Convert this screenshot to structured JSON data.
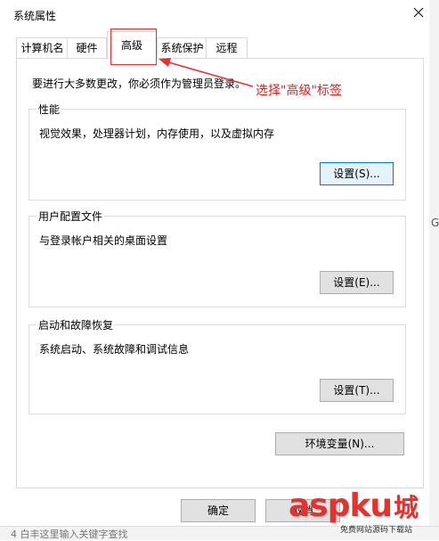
{
  "window": {
    "title": "系统属性"
  },
  "tabs": [
    {
      "label": "计算机名",
      "active": false
    },
    {
      "label": "硬件",
      "active": false
    },
    {
      "label": "高级",
      "active": true
    },
    {
      "label": "系统保护",
      "active": false
    },
    {
      "label": "远程",
      "active": false
    }
  ],
  "panel": {
    "hint": "要进行大多数更改，你必须作为管理员登录。"
  },
  "groups": {
    "performance": {
      "title": "性能",
      "desc": "视觉效果，处理器计划，内存使用，以及虚拟内存",
      "button": "设置(S)..."
    },
    "profiles": {
      "title": "用户配置文件",
      "desc": "与登录帐户相关的桌面设置",
      "button": "设置(E)..."
    },
    "startup": {
      "title": "启动和故障恢复",
      "desc": "系统启动、系统故障和调试信息",
      "button": "设置(T)..."
    }
  },
  "env_button": "环境变量(N)...",
  "footer": {
    "ok": "确定",
    "cancel": "取消"
  },
  "annotation": {
    "text": "选择\"高级\"标签",
    "color": "#e02020"
  },
  "watermark": {
    "text": "aspku",
    "cjk": "城",
    "sub": "免费网站源码下载站"
  },
  "side_char": "G",
  "bottom_text": "4   白丰这里输入关键字查找",
  "colors": {
    "accent": "#0078d7",
    "annotation": "#ea3030"
  }
}
